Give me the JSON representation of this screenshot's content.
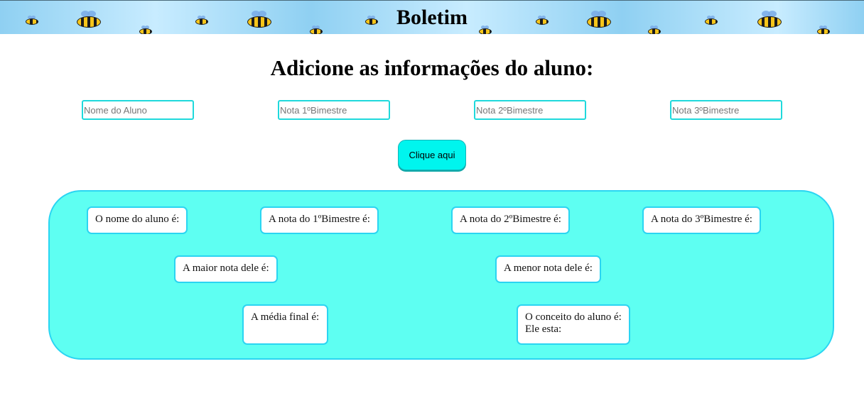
{
  "header": {
    "title": "Boletim",
    "decoration_icons": [
      "bee-icon"
    ]
  },
  "main": {
    "heading": "Adicione as informações do aluno:",
    "inputs": {
      "student_name_placeholder": "Nome do Aluno",
      "grade1_placeholder": "Nota 1ºBimestre",
      "grade2_placeholder": "Nota 2ºBimestre",
      "grade3_placeholder": "Nota 3ºBimestre"
    },
    "submit_label": "Clique aqui"
  },
  "results": {
    "student_name_label": "O nome do aluno é:",
    "grade1_label": "A nota do 1ºBimestre é:",
    "grade2_label": "A nota do 2ºBimestre é:",
    "grade3_label": "A nota do 3ºBimestre é:",
    "highest_grade_label": "A maior nota dele é:",
    "lowest_grade_label": "A menor nota dele é:",
    "final_average_label": "A média final é:",
    "concept_label": "O conceito do aluno é:",
    "status_label": "Ele esta:"
  },
  "colors": {
    "accent": "#00f5ee",
    "panel_background": "#5efff2",
    "border": "#2ad5f2",
    "header_background": "#8fd0f2"
  }
}
